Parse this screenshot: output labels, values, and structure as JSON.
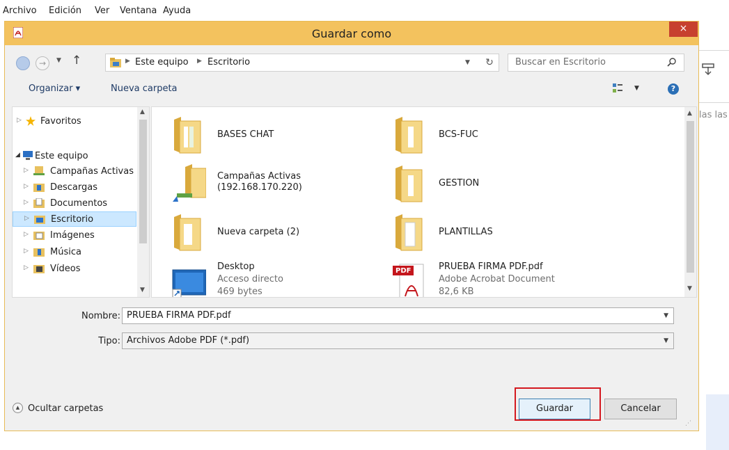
{
  "app_menu": [
    "Archivo",
    "Edición",
    "Ver",
    "Ventana",
    "Ayuda"
  ],
  "dialog": {
    "title": "Guardar como",
    "close_glyph": "×"
  },
  "nav": {
    "breadcrumb": [
      "Este equipo",
      "Escritorio"
    ],
    "search_placeholder": "Buscar en Escritorio"
  },
  "toolbar": {
    "organize_label": "Organizar ▾",
    "new_folder_label": "Nueva carpeta"
  },
  "background_app": {
    "partial_text": "las las"
  },
  "tree": {
    "favorites": "Favoritos",
    "this_pc": "Este equipo",
    "children": [
      "Campañas Activas",
      "Descargas",
      "Documentos",
      "Escritorio",
      "Imágenes",
      "Música",
      "Vídeos"
    ],
    "selected": "Escritorio"
  },
  "files": [
    {
      "name": "BASES CHAT",
      "type": "folder"
    },
    {
      "name": "BCS-FUC",
      "type": "folder"
    },
    {
      "name": "Campañas Activas",
      "sub": "(192.168.170.220)",
      "type": "network-folder"
    },
    {
      "name": "GESTION",
      "type": "folder"
    },
    {
      "name": "Nueva carpeta (2)",
      "type": "folder"
    },
    {
      "name": "PLANTILLAS",
      "type": "folder"
    },
    {
      "name": "Desktop",
      "sub1": "Acceso directo",
      "sub2": "469 bytes",
      "type": "shortcut"
    },
    {
      "name": "PRUEBA FIRMA PDF.pdf",
      "sub1": "Adobe Acrobat Document",
      "sub2": "82,6 KB",
      "type": "pdf"
    }
  ],
  "form": {
    "name_label": "Nombre:",
    "name_value": "PRUEBA FIRMA PDF.pdf",
    "type_label": "Tipo:",
    "type_value": "Archivos Adobe PDF (*.pdf)"
  },
  "footer": {
    "hide_folders": "Ocultar carpetas",
    "save_label": "Guardar",
    "cancel_label": "Cancelar"
  },
  "pdf_badge": "PDF",
  "colors": {
    "titlebar": "#f3c25e",
    "close_button": "#c7402f",
    "selection": "#cce8ff",
    "highlight_frame": "#d4181f"
  }
}
